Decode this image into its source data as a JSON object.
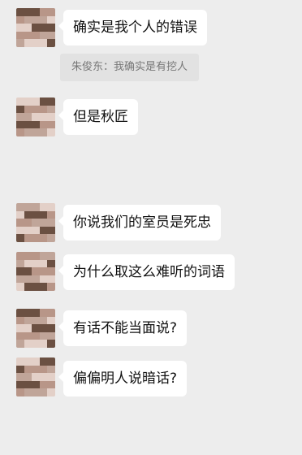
{
  "messages": [
    {
      "text": "确实是我个人的错误"
    },
    {
      "text": "但是秋匠"
    },
    {
      "text": "你说我们的室员是死忠"
    },
    {
      "text": "为什么取这么难听的词语"
    },
    {
      "text": "有话不能当面说?"
    },
    {
      "text": "偏偏明人说暗话?"
    }
  ],
  "quote": {
    "text": "朱俊东：我确实是有挖人"
  },
  "colors": {
    "background": "#ededed",
    "bubble": "#ffffff",
    "quote_bg": "#e2e2e2",
    "quote_text": "#777777"
  },
  "avatar_palette": [
    "#6b5042",
    "#a08776",
    "#d7c3b7",
    "#e3d0c8",
    "#8e6d5b",
    "#4a3730",
    "#c0a599",
    "#f0e3dc",
    "#7a5e52",
    "#b89688",
    "#3a2c28",
    "#d8c9c0"
  ]
}
